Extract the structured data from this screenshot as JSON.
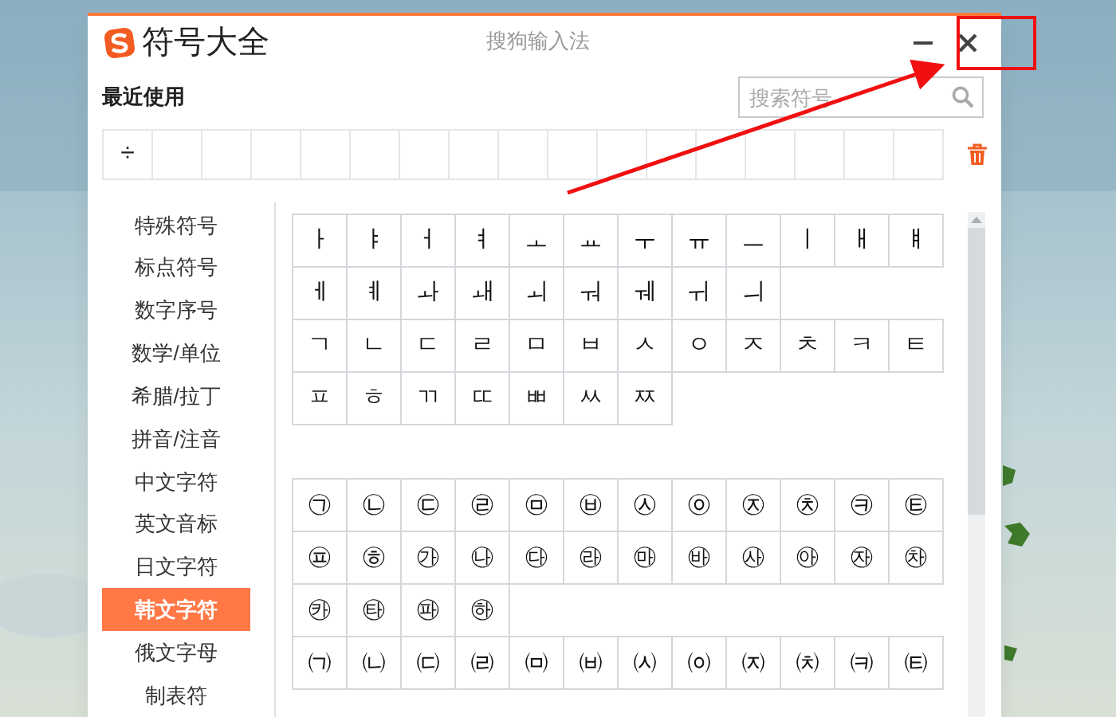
{
  "window": {
    "title": "符号大全",
    "app_name": "搜狗输入法"
  },
  "recent": {
    "label": "最近使用",
    "symbols": [
      "÷"
    ]
  },
  "search": {
    "placeholder": "搜索符号"
  },
  "categories": [
    {
      "label": "特殊符号",
      "selected": false
    },
    {
      "label": "标点符号",
      "selected": false
    },
    {
      "label": "数字序号",
      "selected": false
    },
    {
      "label": "数学/单位",
      "selected": false
    },
    {
      "label": "希腊/拉丁",
      "selected": false
    },
    {
      "label": "拼音/注音",
      "selected": false
    },
    {
      "label": "中文字符",
      "selected": false
    },
    {
      "label": "英文音标",
      "selected": false
    },
    {
      "label": "日文字符",
      "selected": false
    },
    {
      "label": "韩文字符",
      "selected": true
    },
    {
      "label": "俄文字母",
      "selected": false
    },
    {
      "label": "制表符",
      "selected": false
    }
  ],
  "sections": [
    {
      "groups": [
        [
          "ㅏ",
          "ㅑ",
          "ㅓ",
          "ㅕ",
          "ㅗ",
          "ㅛ",
          "ㅜ",
          "ㅠ",
          "ㅡ",
          "ㅣ",
          "ㅐ",
          "ㅒ",
          "ㅔ",
          "ㅖ",
          "ㅘ",
          "ㅙ",
          "ㅚ",
          "ㅝ",
          "ㅞ",
          "ㅟ",
          "ㅢ"
        ],
        [
          "ㄱ",
          "ㄴ",
          "ㄷ",
          "ㄹ",
          "ㅁ",
          "ㅂ",
          "ㅅ",
          "ㅇ",
          "ㅈ",
          "ㅊ",
          "ㅋ",
          "ㅌ",
          "ㅍ",
          "ㅎ",
          "ㄲ",
          "ㄸ",
          "ㅃ",
          "ㅆ",
          "ㅉ"
        ]
      ]
    },
    {
      "groups": [
        [
          "㉠",
          "㉡",
          "㉢",
          "㉣",
          "㉤",
          "㉥",
          "㉦",
          "㉧",
          "㉨",
          "㉩",
          "㉪",
          "㉫",
          "㉬",
          "㉭",
          "㉮",
          "㉯",
          "㉰",
          "㉱",
          "㉲",
          "㉳",
          "㉴",
          "㉵",
          "㉶",
          "㉷",
          "㉸",
          "㉹",
          "㉺",
          "㉻"
        ],
        [
          "㈀",
          "㈁",
          "㈂",
          "㈃",
          "㈄",
          "㈅",
          "㈆",
          "㈇",
          "㈈",
          "㈉",
          "㈊",
          "㈋"
        ]
      ]
    }
  ]
}
